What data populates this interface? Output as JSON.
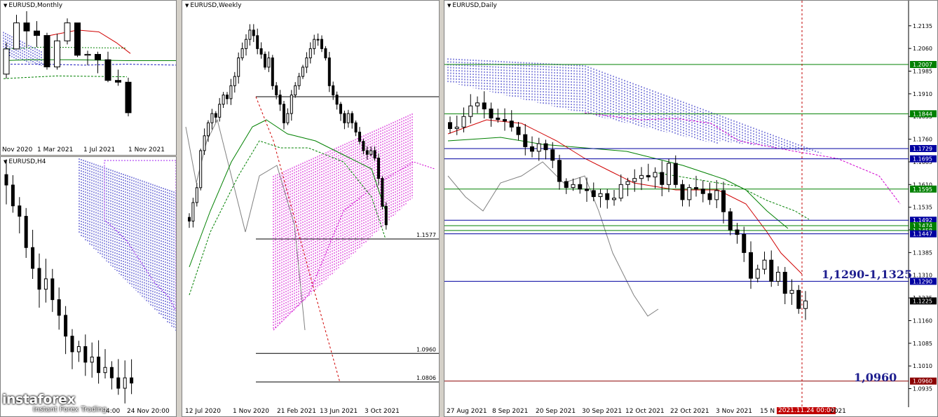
{
  "brand": {
    "name": "instaforex",
    "tagline": "Instant Forex Trading"
  },
  "monthly": {
    "title": "EURUSD,Monthly",
    "x_labels": [
      "Nov 2020",
      "1 Mar 2021",
      "1 Jul 2021",
      "1 Nov 2021"
    ]
  },
  "h4": {
    "title": "EURUSD,H4",
    "x_labels": [
      "4:00",
      "24 Nov 20:00"
    ]
  },
  "weekly": {
    "title": "EURUSD,Weekly",
    "x_labels": [
      "12 Jul 2020",
      "1 Nov 2020",
      "21 Feb 2021",
      "13 Jun 2021",
      "3 Oct 2021"
    ],
    "levels": [
      {
        "label": "1.1577",
        "value": 1.1577
      },
      {
        "label": "1.0960",
        "value": 1.096
      },
      {
        "label": "1.0806",
        "value": 1.0806
      }
    ]
  },
  "daily": {
    "title": "EURUSD,Daily",
    "x_labels": [
      "27 Aug 2021",
      "8 Sep 2021",
      "20 Sep 2021",
      "30 Sep 2021",
      "12 Oct 2021",
      "22 Oct 2021",
      "3 Nov 2021",
      "15 N",
      "2021"
    ],
    "cursor_time": "2021.11.24 00:00",
    "annotation_zone": "1,1290-1,1325",
    "annotation_target": "1,0960"
  },
  "chart_data": [
    {
      "type": "candlestick",
      "title": "EURUSD,Monthly",
      "symbol": "EURUSD",
      "timeframe": "Monthly",
      "x": [
        "2020-11",
        "2020-12",
        "2021-01",
        "2021-02",
        "2021-03",
        "2021-04",
        "2021-05",
        "2021-06",
        "2021-07",
        "2021-08",
        "2021-09",
        "2021-10",
        "2021-11"
      ],
      "open": [
        1.165,
        1.193,
        1.222,
        1.213,
        1.208,
        1.173,
        1.202,
        1.222,
        1.186,
        1.187,
        1.181,
        1.158,
        1.156
      ],
      "high": [
        1.2,
        1.231,
        1.235,
        1.224,
        1.211,
        1.21,
        1.227,
        1.222,
        1.191,
        1.19,
        1.19,
        1.17,
        1.161
      ],
      "low": [
        1.16,
        1.193,
        1.195,
        1.195,
        1.17,
        1.17,
        1.198,
        1.184,
        1.175,
        1.166,
        1.156,
        1.152,
        1.118
      ],
      "close": [
        1.193,
        1.222,
        1.213,
        1.208,
        1.173,
        1.202,
        1.222,
        1.186,
        1.187,
        1.181,
        1.158,
        1.156,
        1.122
      ]
    },
    {
      "type": "candlestick",
      "title": "EURUSD,H4",
      "symbol": "EURUSD",
      "timeframe": "H4",
      "close_path": [
        1.162,
        1.158,
        1.156,
        1.15,
        1.146,
        1.142,
        1.144,
        1.14,
        1.137,
        1.133,
        1.13,
        1.131,
        1.128,
        1.129,
        1.126,
        1.127,
        1.125,
        1.123,
        1.125,
        1.124
      ]
    },
    {
      "type": "candlestick",
      "title": "EURUSD,Weekly",
      "symbol": "EURUSD",
      "timeframe": "Weekly",
      "levels": [
        1.1577,
        1.096,
        1.0806
      ],
      "close_path": [
        1.122,
        1.132,
        1.14,
        1.16,
        1.168,
        1.175,
        1.18,
        1.178,
        1.185,
        1.19,
        1.188,
        1.195,
        1.2,
        1.21,
        1.215,
        1.22,
        1.225,
        1.222,
        1.215,
        1.212,
        1.205,
        1.21,
        1.195,
        1.19,
        1.185,
        1.175,
        1.18,
        1.19,
        1.195,
        1.2,
        1.205,
        1.21,
        1.215,
        1.22,
        1.22,
        1.215,
        1.21,
        1.195,
        1.19,
        1.185,
        1.18,
        1.175,
        1.18,
        1.175,
        1.17,
        1.165,
        1.16,
        1.158,
        1.16,
        1.156,
        1.145,
        1.13,
        1.12
      ]
    },
    {
      "type": "candlestick",
      "title": "EURUSD,Daily",
      "symbol": "EURUSD",
      "timeframe": "Daily",
      "y_ticks": [
        1.2135,
        1.206,
        1.1985,
        1.191,
        1.1835,
        1.176,
        1.1685,
        1.161,
        1.1535,
        1.146,
        1.1385,
        1.131,
        1.1235,
        1.116,
        1.1085,
        1.101,
        1.0935
      ],
      "ylim": [
        1.092,
        1.216
      ],
      "levels": [
        {
          "label": "1.2007",
          "value": 1.2007,
          "color": "#008000"
        },
        {
          "label": "1.1844",
          "value": 1.1844,
          "color": "#008000"
        },
        {
          "label": "1.1729",
          "value": 1.1729,
          "color": "#0000a0"
        },
        {
          "label": "1.1695",
          "value": 1.1695,
          "color": "#0000a0"
        },
        {
          "label": "1.1595",
          "value": 1.1595,
          "color": "#008000"
        },
        {
          "label": "1.1492",
          "value": 1.1492,
          "color": "#0000a0"
        },
        {
          "label": "1.1474",
          "value": 1.1474,
          "color": "#008000"
        },
        {
          "label": "1.1458",
          "value": 1.1458,
          "color": "#008000"
        },
        {
          "label": "1.1447",
          "value": 1.1447,
          "color": "#0000a0"
        },
        {
          "label": "1.1290",
          "value": 1.129,
          "color": "#0000a0"
        },
        {
          "label": "1.1225",
          "value": 1.1225,
          "color": "#000000"
        },
        {
          "label": "1.0960",
          "value": 1.096,
          "color": "#8b0000"
        }
      ],
      "close_path": [
        1.1795,
        1.18,
        1.1835,
        1.187,
        1.188,
        1.186,
        1.183,
        1.1825,
        1.182,
        1.18,
        1.1775,
        1.1735,
        1.172,
        1.1745,
        1.1725,
        1.169,
        1.162,
        1.16,
        1.161,
        1.1595,
        1.159,
        1.157,
        1.158,
        1.156,
        1.1565,
        1.161,
        1.162,
        1.163,
        1.164,
        1.1635,
        1.165,
        1.161,
        1.168,
        1.161,
        1.156,
        1.16,
        1.1595,
        1.158,
        1.156,
        1.159,
        1.152,
        1.146,
        1.1445,
        1.1385,
        1.13,
        1.133,
        1.136,
        1.129,
        1.132,
        1.125,
        1.126,
        1.12,
        1.1225
      ]
    }
  ]
}
